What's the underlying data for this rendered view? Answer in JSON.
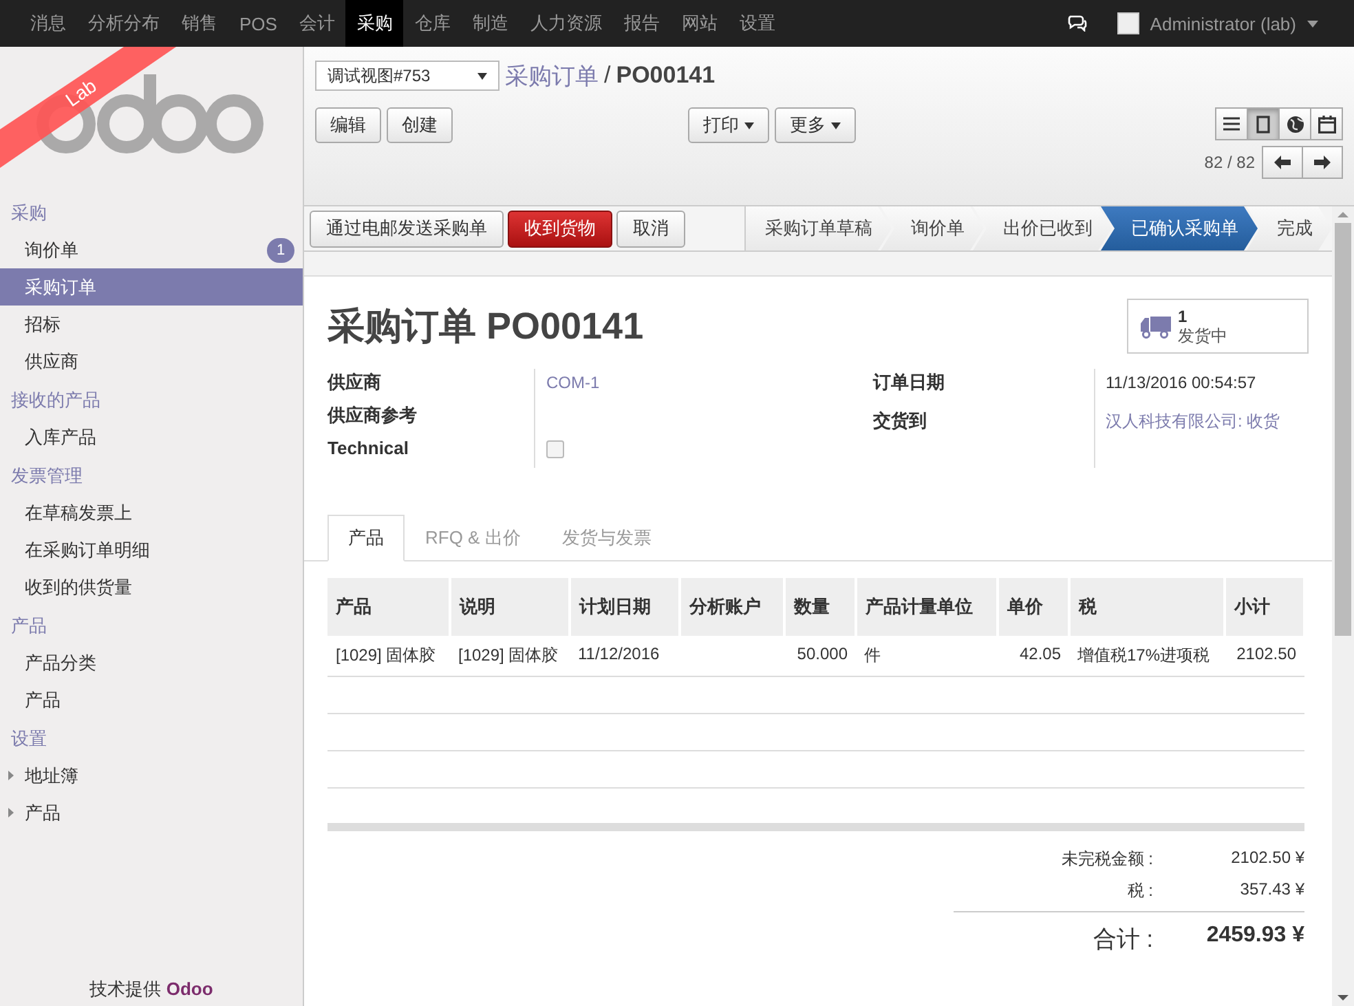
{
  "top_menu": [
    {
      "label": "消息",
      "selected": false
    },
    {
      "label": "分析分布",
      "selected": false
    },
    {
      "label": "销售",
      "selected": false
    },
    {
      "label": "POS",
      "selected": false
    },
    {
      "label": "会计",
      "selected": false
    },
    {
      "label": "采购",
      "selected": true
    },
    {
      "label": "仓库",
      "selected": false
    },
    {
      "label": "制造",
      "selected": false
    },
    {
      "label": "人力资源",
      "selected": false
    },
    {
      "label": "报告",
      "selected": false
    },
    {
      "label": "网站",
      "selected": false
    },
    {
      "label": "设置",
      "selected": false
    }
  ],
  "user": {
    "name": "Administrator (lab)"
  },
  "sidebar": {
    "ribbon": "Lab",
    "sections": [
      {
        "title": "采购",
        "items": [
          {
            "label": "询价单",
            "badge": "1",
            "selected": false,
            "kind": "link"
          },
          {
            "label": "采购订单",
            "selected": true,
            "kind": "link"
          },
          {
            "label": "招标",
            "selected": false,
            "kind": "link"
          },
          {
            "label": "供应商",
            "selected": false,
            "kind": "link"
          }
        ]
      },
      {
        "title": "接收的产品",
        "items": [
          {
            "label": "入库产品",
            "selected": false,
            "kind": "link"
          }
        ]
      },
      {
        "title": "发票管理",
        "items": [
          {
            "label": "在草稿发票上",
            "selected": false,
            "kind": "link"
          },
          {
            "label": "在采购订单明细",
            "selected": false,
            "kind": "link"
          },
          {
            "label": "收到的供货量",
            "selected": false,
            "kind": "link"
          }
        ]
      },
      {
        "title": "产品",
        "items": [
          {
            "label": "产品分类",
            "selected": false,
            "kind": "link"
          },
          {
            "label": "产品",
            "selected": false,
            "kind": "link"
          }
        ]
      },
      {
        "title": "设置",
        "items": [
          {
            "label": "地址簿",
            "selected": false,
            "kind": "folder"
          },
          {
            "label": "产品",
            "selected": false,
            "kind": "folder"
          }
        ]
      }
    ],
    "footer_text": "技术提供",
    "footer_brand": "Odoo"
  },
  "header": {
    "view_select": "调试视图#753",
    "breadcrumb": [
      {
        "label": "采购订单",
        "kind": "link"
      },
      {
        "label": "/",
        "kind": "separator"
      },
      {
        "label": "PO00141",
        "kind": "current"
      }
    ],
    "left_buttons": [
      "编辑",
      "创建"
    ],
    "menus": [
      "打印",
      "更多"
    ],
    "views": [
      {
        "kind": "list",
        "selected": false
      },
      {
        "kind": "form",
        "selected": true
      },
      {
        "kind": "map",
        "selected": false
      },
      {
        "kind": "calendar",
        "selected": false
      }
    ],
    "pager": "82 / 82"
  },
  "actions": [
    {
      "label": "通过电邮发送采购单",
      "kind": "default"
    },
    {
      "label": "收到货物",
      "kind": "primary"
    },
    {
      "label": "取消",
      "kind": "default"
    }
  ],
  "stages": [
    {
      "label": "采购订单草稿",
      "selected": false
    },
    {
      "label": "询价单",
      "selected": false
    },
    {
      "label": "出价已收到",
      "selected": false
    },
    {
      "label": "已确认采购单",
      "selected": true
    },
    {
      "label": "完成",
      "selected": false
    }
  ],
  "sheet": {
    "title": "采购订单 PO00141",
    "smart_button": {
      "count": "1",
      "label": "发货中"
    },
    "left_fields": [
      {
        "label": "供应商",
        "kind": "link",
        "value": "COM-1"
      },
      {
        "label": "供应商参考",
        "kind": "text"
      },
      {
        "label": "Technical",
        "kind": "checkbox",
        "checked": false
      }
    ],
    "right_fields": [
      {
        "label": "订单日期",
        "kind": "text",
        "value": "11/13/2016 00:54:57"
      },
      {
        "label": "交货到",
        "kind": "link",
        "value": "汉人科技有限公司: 收货"
      }
    ],
    "tabs": [
      {
        "label": "产品",
        "selected": true
      },
      {
        "label": "RFQ & 出价",
        "selected": false
      },
      {
        "label": "发货与发票",
        "selected": false
      }
    ],
    "table": {
      "columns": [
        {
          "label": "产品",
          "kind": "text"
        },
        {
          "label": "说明",
          "kind": "text"
        },
        {
          "label": "计划日期",
          "kind": "text"
        },
        {
          "label": "分析账户",
          "kind": "text"
        },
        {
          "label": "数量",
          "kind": "number"
        },
        {
          "label": "产品计量单位",
          "kind": "text"
        },
        {
          "label": "单价",
          "kind": "number"
        },
        {
          "label": "税",
          "kind": "text"
        },
        {
          "label": "小计",
          "kind": "number"
        }
      ],
      "rows": [
        [
          "[1029] 固体胶",
          "[1029] 固体胶",
          "11/12/2016",
          "",
          "50.000",
          "件",
          "42.05",
          "增值税17%进项税",
          "2102.50"
        ]
      ]
    },
    "totals": [
      {
        "label": "未完税金额 :",
        "value": "2102.50 ¥"
      },
      {
        "label": "税 :",
        "value": "357.43 ¥"
      }
    ],
    "grand_total": {
      "label": "合计 :",
      "value": "2459.93 ¥"
    }
  }
}
